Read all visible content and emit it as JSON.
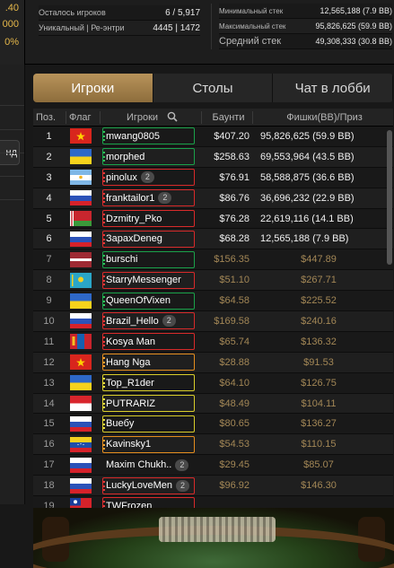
{
  "left_edge": {
    "values": [
      ".40",
      "000",
      "0%"
    ],
    "button_label": "нд"
  },
  "stats_left": [
    {
      "label": "Осталось игроков",
      "value": "6 / 5,917"
    },
    {
      "label": "Уникальный | Ре-энтри",
      "value": "4445 | 1472"
    }
  ],
  "stats_right": [
    {
      "label": "Минимальный стек",
      "value": "12,565,188 (7.9 BB)"
    },
    {
      "label": "Максимальный стек",
      "value": "95,826,625 (59.9 BB)"
    },
    {
      "label": "Средний стек",
      "value": "49,308,333 (30.8 BB)"
    }
  ],
  "tabs": [
    {
      "label": "Игроки",
      "active": true
    },
    {
      "label": "Столы",
      "active": false
    },
    {
      "label": "Чат в лобби",
      "active": false
    }
  ],
  "columns": {
    "pos": "Поз.",
    "flag": "Флаг",
    "players": "Игроки",
    "bounty": "Баунти",
    "chips": "Фишки(BB)/Приз"
  },
  "players": [
    {
      "pos": "1",
      "flag": "vietnam",
      "name": "mwang0805",
      "badge": "",
      "frame": "green",
      "bounty": "$407.20",
      "chips": "95,826,625 (59.9 BB)",
      "active": true
    },
    {
      "pos": "2",
      "flag": "ukraine",
      "name": "morphed",
      "badge": "",
      "frame": "green",
      "bounty": "$258.63",
      "chips": "69,553,964 (43.5 BB)",
      "active": true
    },
    {
      "pos": "3",
      "flag": "argentina",
      "name": "pinolux",
      "badge": "2",
      "frame": "red",
      "bounty": "$76.91",
      "chips": "58,588,875 (36.6 BB)",
      "active": true
    },
    {
      "pos": "4",
      "flag": "russia",
      "name": "franktailor1",
      "badge": "2",
      "frame": "red",
      "bounty": "$86.76",
      "chips": "36,696,232 (22.9 BB)",
      "active": true
    },
    {
      "pos": "5",
      "flag": "belarus",
      "name": "Dzmitry_Pko",
      "badge": "",
      "frame": "red",
      "bounty": "$76.28",
      "chips": "22,619,116 (14.1 BB)",
      "active": true
    },
    {
      "pos": "6",
      "flag": "russia",
      "name": "ЗapaxDeneg",
      "badge": "",
      "frame": "red",
      "bounty": "$68.28",
      "chips": "12,565,188 (7.9 BB)",
      "active": true
    },
    {
      "pos": "7",
      "flag": "latvia",
      "name": "burschi",
      "badge": "",
      "frame": "green",
      "bounty": "$156.35",
      "chips": "$447.89",
      "active": false
    },
    {
      "pos": "8",
      "flag": "kazakhstan",
      "name": "StarryMessenger",
      "badge": "",
      "frame": "red",
      "bounty": "$51.10",
      "chips": "$267.71",
      "active": false
    },
    {
      "pos": "9",
      "flag": "ukraine",
      "name": "QueenOfVixen",
      "badge": "",
      "frame": "green",
      "bounty": "$64.58",
      "chips": "$225.52",
      "active": false
    },
    {
      "pos": "10",
      "flag": "russia",
      "name": "Brazil_Hello",
      "badge": "2",
      "frame": "red",
      "bounty": "$169.58",
      "chips": "$240.16",
      "active": false
    },
    {
      "pos": "11",
      "flag": "mongolia",
      "name": "Kosya Man",
      "badge": "",
      "frame": "red",
      "bounty": "$65.74",
      "chips": "$136.32",
      "active": false
    },
    {
      "pos": "12",
      "flag": "vietnam",
      "name": "Hang Nga",
      "badge": "",
      "frame": "orange",
      "bounty": "$28.88",
      "chips": "$91.53",
      "active": false
    },
    {
      "pos": "13",
      "flag": "ukraine",
      "name": "Top_R1der",
      "badge": "",
      "frame": "yellow",
      "bounty": "$64.10",
      "chips": "$126.75",
      "active": false
    },
    {
      "pos": "14",
      "flag": "indonesia",
      "name": "PUTRARIZ",
      "badge": "",
      "frame": "yellow",
      "bounty": "$48.49",
      "chips": "$104.11",
      "active": false
    },
    {
      "pos": "15",
      "flag": "russia",
      "name": "Bueбy",
      "badge": "",
      "frame": "yellow",
      "bounty": "$80.65",
      "chips": "$136.27",
      "active": false
    },
    {
      "pos": "16",
      "flag": "venezuela",
      "name": "Kavinsky1",
      "badge": "",
      "frame": "orange",
      "bounty": "$54.53",
      "chips": "$110.15",
      "active": false
    },
    {
      "pos": "17",
      "flag": "russia",
      "name": "Maxim Chukh..",
      "badge": "2",
      "frame": "plain",
      "bounty": "$29.45",
      "chips": "$85.07",
      "active": false
    },
    {
      "pos": "18",
      "flag": "russia",
      "name": "LuckyLoveMen",
      "badge": "2",
      "frame": "red",
      "bounty": "$96.92",
      "chips": "$146.30",
      "active": false
    },
    {
      "pos": "19",
      "flag": "taiwan",
      "name": "TWFrozen",
      "badge": "",
      "frame": "red",
      "bounty": "",
      "chips": "",
      "active": false
    }
  ]
}
